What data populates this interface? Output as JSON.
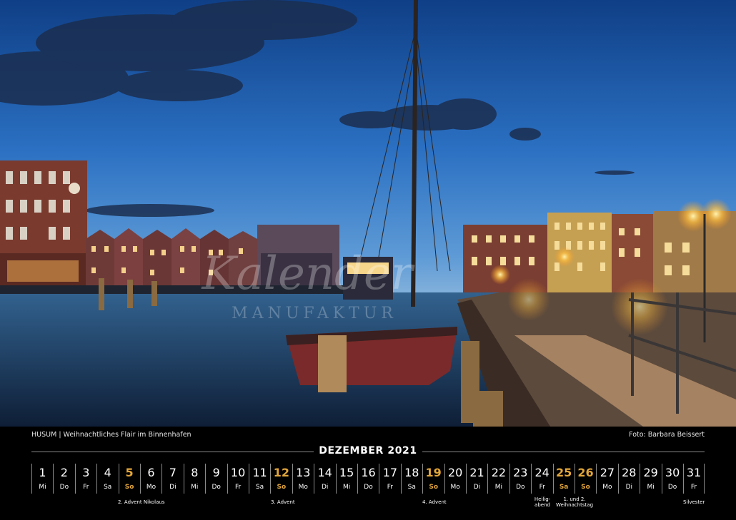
{
  "caption": {
    "place": "HUSUM",
    "separator": "|",
    "title": "Weihnachtliches Flair im Binnenhafen",
    "credit": "Foto: Barbara Beissert"
  },
  "watermark": "Kalender MANUFAKTUR",
  "calendar": {
    "month": "DEZEMBER 2021",
    "highlight_color": "#e2a63a",
    "days": [
      {
        "num": "1",
        "wd": "Mi",
        "hl": false
      },
      {
        "num": "2",
        "wd": "Do",
        "hl": false
      },
      {
        "num": "3",
        "wd": "Fr",
        "hl": false
      },
      {
        "num": "4",
        "wd": "Sa",
        "hl": false
      },
      {
        "num": "5",
        "wd": "So",
        "hl": true
      },
      {
        "num": "6",
        "wd": "Mo",
        "hl": false
      },
      {
        "num": "7",
        "wd": "Di",
        "hl": false
      },
      {
        "num": "8",
        "wd": "Mi",
        "hl": false
      },
      {
        "num": "9",
        "wd": "Do",
        "hl": false
      },
      {
        "num": "10",
        "wd": "Fr",
        "hl": false
      },
      {
        "num": "11",
        "wd": "Sa",
        "hl": false
      },
      {
        "num": "12",
        "wd": "So",
        "hl": true
      },
      {
        "num": "13",
        "wd": "Mo",
        "hl": false
      },
      {
        "num": "14",
        "wd": "Di",
        "hl": false
      },
      {
        "num": "15",
        "wd": "Mi",
        "hl": false
      },
      {
        "num": "16",
        "wd": "Do",
        "hl": false
      },
      {
        "num": "17",
        "wd": "Fr",
        "hl": false
      },
      {
        "num": "18",
        "wd": "Sa",
        "hl": false
      },
      {
        "num": "19",
        "wd": "So",
        "hl": true
      },
      {
        "num": "20",
        "wd": "Mo",
        "hl": false
      },
      {
        "num": "21",
        "wd": "Di",
        "hl": false
      },
      {
        "num": "22",
        "wd": "Mi",
        "hl": false
      },
      {
        "num": "23",
        "wd": "Do",
        "hl": false
      },
      {
        "num": "24",
        "wd": "Fr",
        "hl": false
      },
      {
        "num": "25",
        "wd": "Sa",
        "hl": true
      },
      {
        "num": "26",
        "wd": "So",
        "hl": true
      },
      {
        "num": "27",
        "wd": "Mo",
        "hl": false
      },
      {
        "num": "28",
        "wd": "Di",
        "hl": false
      },
      {
        "num": "29",
        "wd": "Mi",
        "hl": false
      },
      {
        "num": "30",
        "wd": "Do",
        "hl": false
      },
      {
        "num": "31",
        "wd": "Fr",
        "hl": false
      }
    ],
    "notes": {
      "advent2": "2. Advent",
      "nikolaus": "Nikolaus",
      "advent3": "3. Advent",
      "advent4": "4. Advent",
      "heiligabend_1": "Heilig-",
      "heiligabend_2": "abend",
      "weihnacht_1": "1. und 2.",
      "weihnacht_2": "Weihnachtstag",
      "silvester": "Silvester"
    }
  }
}
